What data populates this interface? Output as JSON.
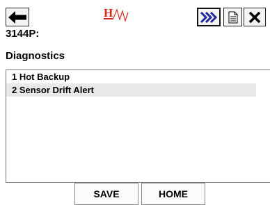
{
  "toolbar": {
    "back_icon": "arrow-left-icon",
    "logo": "hart-logo",
    "forward_icon": "double-chevron-right-icon",
    "document_icon": "document-icon",
    "close_icon": "close-x-icon"
  },
  "header": {
    "device_tag": "3144P:",
    "page_title": "Diagnostics"
  },
  "menu": {
    "items": [
      {
        "label": "1 Hot Backup",
        "selected": false
      },
      {
        "label": "2 Sensor Drift Alert",
        "selected": true
      }
    ]
  },
  "footer": {
    "save_label": "SAVE",
    "home_label": "HOME"
  },
  "colors": {
    "logo_red": "#d9261c",
    "forward_blue": "#1f2a9e",
    "selection_bg": "#e8e8e8"
  }
}
